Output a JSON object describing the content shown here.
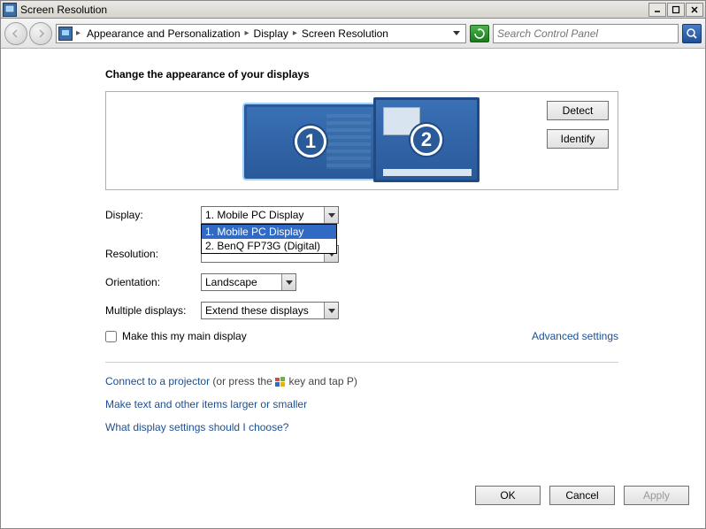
{
  "window": {
    "title": "Screen Resolution"
  },
  "breadcrumb": {
    "items": [
      "Appearance and Personalization",
      "Display",
      "Screen Resolution"
    ]
  },
  "search": {
    "placeholder": "Search Control Panel"
  },
  "heading": "Change the appearance of your displays",
  "panel_buttons": {
    "detect": "Detect",
    "identify": "Identify"
  },
  "monitors": {
    "m1": "1",
    "m2": "2"
  },
  "form": {
    "display_label": "Display:",
    "display_value": "1. Mobile PC Display",
    "display_options": [
      "1. Mobile PC Display",
      "2. BenQ FP73G (Digital)"
    ],
    "resolution_label": "Resolution:",
    "resolution_value": "",
    "orientation_label": "Orientation:",
    "orientation_value": "Landscape",
    "multiple_label": "Multiple displays:",
    "multiple_value": "Extend these displays"
  },
  "checkbox": {
    "label": "Make this my main display"
  },
  "advanced": "Advanced settings",
  "links": {
    "projector_link": "Connect to a projector",
    "projector_suffix_a": " (or press the ",
    "projector_suffix_b": " key and tap P)",
    "larger": "Make text and other items larger or smaller",
    "help": "What display settings should I choose?"
  },
  "buttons": {
    "ok": "OK",
    "cancel": "Cancel",
    "apply": "Apply"
  }
}
